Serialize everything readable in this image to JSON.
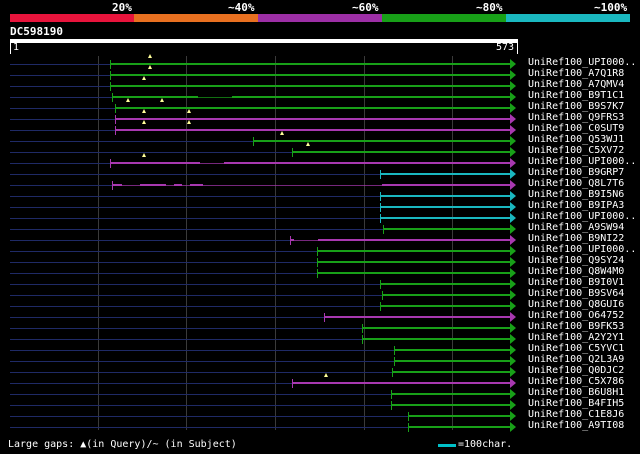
{
  "legend": {
    "labels": [
      "20%",
      "~40%",
      "~60%",
      "~80%",
      "~100%"
    ],
    "colors": [
      "#e8143c",
      "#e87020",
      "#9d2fa6",
      "#18a018",
      "#1ab8c0"
    ]
  },
  "query": {
    "id": "DC598190",
    "start": "1",
    "end": "573"
  },
  "colors": {
    "magenta": "#a838b0",
    "green": "#18a018",
    "cyan": "#1ab8c0",
    "track": "#1f2a66",
    "gap_marker": "#ffff99"
  },
  "hits": [
    {
      "label": "UniRef100_UPI000..",
      "color": "green"
    },
    {
      "label": "UniRef100_A7Q1R8",
      "color": "green"
    },
    {
      "label": "UniRef100_A7QMV4",
      "color": "green"
    },
    {
      "label": "UniRef100_B9T1C1",
      "color": "green"
    },
    {
      "label": "UniRef100_B9S7K7",
      "color": "green"
    },
    {
      "label": "UniRef100_Q9FRS3",
      "color": "magenta"
    },
    {
      "label": "UniRef100_C0SUT9",
      "color": "magenta"
    },
    {
      "label": "UniRef100_Q53WJ1",
      "color": "green"
    },
    {
      "label": "UniRef100_C5XV72",
      "color": "green"
    },
    {
      "label": "UniRef100_UPI000..",
      "color": "magenta"
    },
    {
      "label": "UniRef100_B9GRP7",
      "color": "cyan"
    },
    {
      "label": "UniRef100_Q8L7T6",
      "color": "magenta"
    },
    {
      "label": "UniRef100_B9I5N6",
      "color": "cyan"
    },
    {
      "label": "UniRef100_B9IPA3",
      "color": "cyan"
    },
    {
      "label": "UniRef100_UPI000..",
      "color": "cyan"
    },
    {
      "label": "UniRef100_A9SW94",
      "color": "green"
    },
    {
      "label": "UniRef100_B9NI22",
      "color": "magenta"
    },
    {
      "label": "UniRef100_UPI000..",
      "color": "green"
    },
    {
      "label": "UniRef100_Q9SY24",
      "color": "green"
    },
    {
      "label": "UniRef100_Q8W4M0",
      "color": "green"
    },
    {
      "label": "UniRef100_B9I0V1",
      "color": "green"
    },
    {
      "label": "UniRef100_B9SV64",
      "color": "green"
    },
    {
      "label": "UniRef100_Q8GUI6",
      "color": "green"
    },
    {
      "label": "UniRef100_O64752",
      "color": "magenta"
    },
    {
      "label": "UniRef100_B9FK53",
      "color": "green"
    },
    {
      "label": "UniRef100_A2Y2Y1",
      "color": "green"
    },
    {
      "label": "UniRef100_C5YVC1",
      "color": "green"
    },
    {
      "label": "UniRef100_Q2L3A9",
      "color": "green"
    },
    {
      "label": "UniRef100_Q0DJC2",
      "color": "green"
    },
    {
      "label": "UniRef100_C5X786",
      "color": "magenta"
    },
    {
      "label": "UniRef100_B6U8H1",
      "color": "green"
    },
    {
      "label": "UniRef100_B4FIH5",
      "color": "green"
    },
    {
      "label": "UniRef100_C1E8J6",
      "color": "green"
    },
    {
      "label": "UniRef100_A9TI08",
      "color": "green"
    }
  ],
  "footer": {
    "note": "Large gaps: ▲(in Query)/~ (in Subject)",
    "scale": "=100char."
  }
}
